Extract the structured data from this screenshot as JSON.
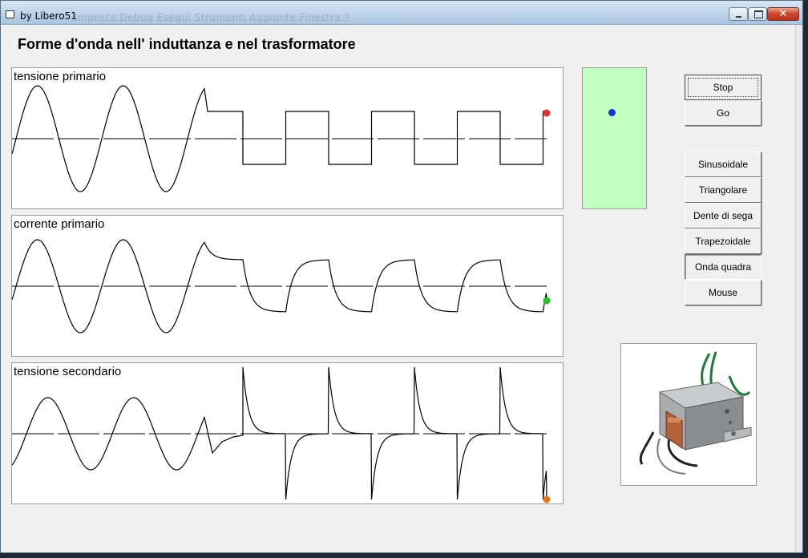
{
  "window": {
    "title": "by Libero51",
    "ghost_menu": "Imposta   Debug   Esegui   Strumenti   Aggiunte   Finestra   ?"
  },
  "heading": "Forme d'onda nell' induttanza e nel trasformatore",
  "panels": [
    {
      "label": "tensione primario",
      "marker_color": "#e03030"
    },
    {
      "label": "corrente primario",
      "marker_color": "#22c022"
    },
    {
      "label": "tensione secondario",
      "marker_color": "#e07a20"
    }
  ],
  "indicator": {
    "background": "#c0ffc0",
    "dot_color": "#1633d6"
  },
  "controls": {
    "stop": "Stop",
    "go": "Go"
  },
  "waveforms": [
    {
      "label": "Sinusoidale"
    },
    {
      "label": "Triangolare"
    },
    {
      "label": "Dente di sega"
    },
    {
      "label": "Trapezoidale"
    },
    {
      "label": "Onda quadra"
    },
    {
      "label": "Mouse"
    }
  ],
  "selected_waveform": "Onda quadra",
  "photo": {
    "subject": "transformer"
  }
}
